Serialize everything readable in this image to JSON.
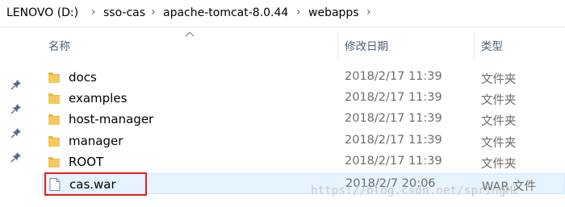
{
  "breadcrumb": {
    "items": [
      "LENOVO (D:)",
      "sso-cas",
      "apache-tomcat-8.0.44",
      "webapps"
    ],
    "separator": "›"
  },
  "columns": {
    "name": "名称",
    "date": "修改日期",
    "type": "类型"
  },
  "files": [
    {
      "name": "docs",
      "date": "2018/2/17 11:39",
      "type": "文件夹",
      "icon": "folder-icon"
    },
    {
      "name": "examples",
      "date": "2018/2/17 11:39",
      "type": "文件夹",
      "icon": "folder-icon"
    },
    {
      "name": "host-manager",
      "date": "2018/2/17 11:39",
      "type": "文件夹",
      "icon": "folder-icon"
    },
    {
      "name": "manager",
      "date": "2018/2/17 11:39",
      "type": "文件夹",
      "icon": "folder-icon"
    },
    {
      "name": "ROOT",
      "date": "2018/2/17 11:39",
      "type": "文件夹",
      "icon": "folder-icon"
    },
    {
      "name": "cas.war",
      "date": "2018/2/7 20:06",
      "type": "WAR 文件",
      "icon": "file-icon"
    }
  ],
  "watermark": "https://blog.csdn.net/springML",
  "colors": {
    "folder": "#e8b44a",
    "highlight": "#e02020",
    "selection": "#e5f3ff",
    "header_text": "#4c607a"
  }
}
